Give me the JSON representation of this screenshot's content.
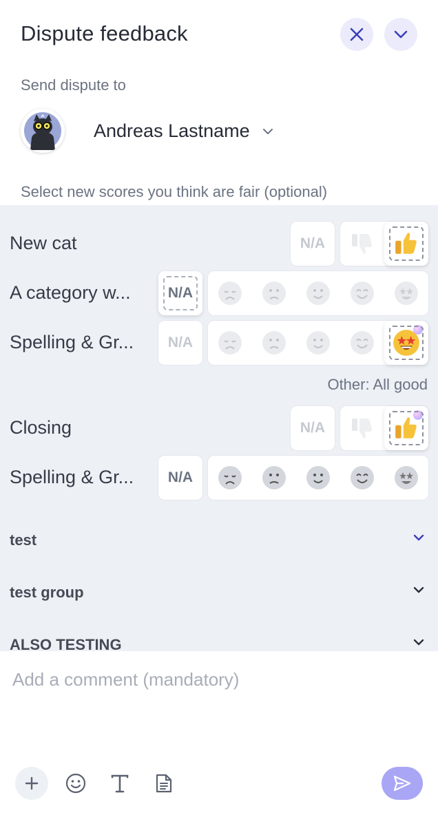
{
  "header": {
    "title": "Dispute feedback",
    "close_icon": "close-icon",
    "collapse_icon": "chevron-down-icon"
  },
  "recipient": {
    "label": "Send dispute to",
    "name": "Andreas Lastname",
    "avatar_icon": "cat-avatar-icon"
  },
  "scores": {
    "hint": "Select new scores you think are fair (optional)",
    "rows": [
      {
        "label": "New cat",
        "type": "binary",
        "na_label": "N/A",
        "selected": "thumbs-up"
      },
      {
        "label": "A category w...",
        "type": "scale",
        "na_label": "N/A",
        "selected": "na"
      },
      {
        "label": "Spelling & Gr...",
        "type": "scale",
        "na_label": "N/A",
        "selected": 5
      },
      {
        "label": "Closing",
        "type": "binary",
        "na_label": "N/A",
        "selected": "thumbs-up"
      },
      {
        "label": "Spelling & Gr...",
        "type": "scale",
        "na_label": "N/A",
        "selected": null
      }
    ],
    "other_note": "Other: All good"
  },
  "groups": [
    {
      "label": "test",
      "chevron_color": "#3b3fb8"
    },
    {
      "label": "test group",
      "chevron_color": "#2b2f3a"
    },
    {
      "label": "ALSO TESTING",
      "chevron_color": "#2b2f3a"
    }
  ],
  "comment": {
    "placeholder": "Add a comment (mandatory)"
  },
  "toolbar": {
    "icons": [
      "plus-icon",
      "emoji-icon",
      "text-format-icon",
      "document-icon",
      "send-icon"
    ]
  },
  "colors": {
    "accent": "#3b3fb8",
    "accent_soft": "#ebebfb",
    "send_button": "#a9a6f6",
    "panel_bg": "#edf0f5"
  }
}
